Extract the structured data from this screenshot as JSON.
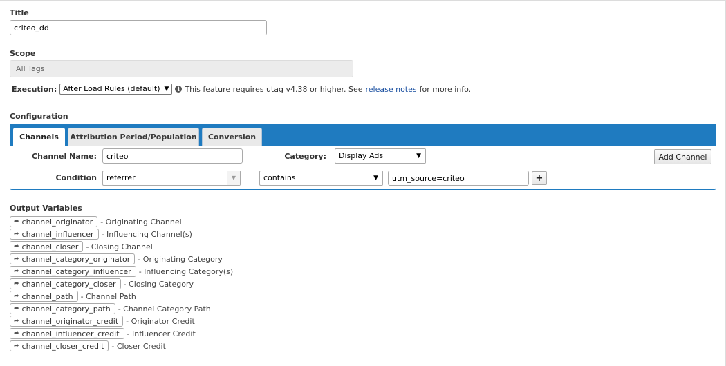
{
  "title_section": {
    "label": "Title",
    "value": "criteo_dd"
  },
  "scope_section": {
    "label": "Scope",
    "value": "All Tags"
  },
  "execution": {
    "label": "Execution:",
    "selected": "After Load Rules (default)",
    "note": "This feature requires utag v4.38 or higher. See",
    "link": "release notes",
    "note_after": "for more info."
  },
  "configuration": {
    "label": "Configuration",
    "tabs": [
      {
        "label": "Channels"
      },
      {
        "label": "Attribution Period/Population"
      },
      {
        "label": "Conversion"
      }
    ],
    "channel_name_label": "Channel Name:",
    "channel_name_value": "criteo",
    "category_label": "Category:",
    "category_value": "Display Ads",
    "add_channel_label": "Add Channel",
    "condition_label": "Condition",
    "condition_source": "referrer",
    "condition_operator": "contains",
    "condition_value": "utm_source=criteo",
    "add_condition_glyph": "+"
  },
  "output_variables": {
    "label": "Output Variables",
    "items": [
      {
        "name": "channel_originator",
        "desc": "- Originating Channel"
      },
      {
        "name": "channel_influencer",
        "desc": "- Influencing Channel(s)"
      },
      {
        "name": "channel_closer",
        "desc": "- Closing Channel"
      },
      {
        "name": "channel_category_originator",
        "desc": "- Originating Category"
      },
      {
        "name": "channel_category_influencer",
        "desc": "- Influencing Category(s)"
      },
      {
        "name": "channel_category_closer",
        "desc": "- Closing Category"
      },
      {
        "name": "channel_path",
        "desc": "- Channel Path"
      },
      {
        "name": "channel_category_path",
        "desc": "- Channel Category Path"
      },
      {
        "name": "channel_originator_credit",
        "desc": "- Originator Credit"
      },
      {
        "name": "channel_influencer_credit",
        "desc": "- Influencer Credit"
      },
      {
        "name": "channel_closer_credit",
        "desc": "- Closer Credit"
      }
    ]
  },
  "icons": {
    "info": "info-circle-icon",
    "variable": "sign-out-icon",
    "dropdown": "caret-down-icon"
  },
  "colors": {
    "accent": "#1f7bc0",
    "link": "#1a4fa0"
  }
}
